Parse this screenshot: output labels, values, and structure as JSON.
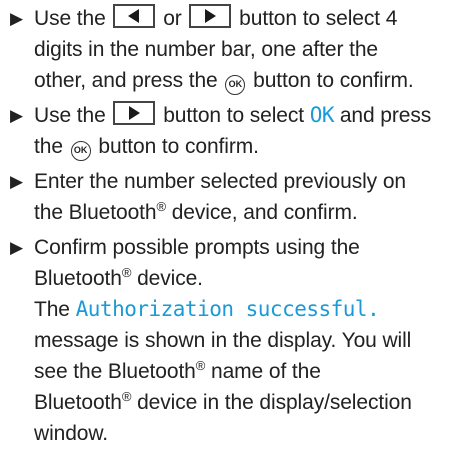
{
  "colors": {
    "text": "#222222",
    "display_text": "#1a9ad6",
    "key_border": "#444444"
  },
  "icons": {
    "bullet": "triangle-right-bullet-icon",
    "left_key": "left-arrow-key-icon",
    "right_key": "right-arrow-key-icon",
    "ok_key": "ok-button-icon"
  },
  "ok_button_label": "OK",
  "reg_mark": "®",
  "step1": {
    "t1": "Use the",
    "t2": "or",
    "t3": "button to select 4",
    "t4": "digits in the number bar, one after the",
    "t5": "other, and press the",
    "t6": "button to confirm."
  },
  "step2": {
    "t1": "Use the",
    "t2": "button to select",
    "display": "OK",
    "t3": "and press",
    "t4": "the",
    "t5": "button to confirm."
  },
  "step3": {
    "t1": "Enter the number selected previously on",
    "t2": "the Bluetooth",
    "t3": "device, and confirm."
  },
  "step4": {
    "t1": "Confirm possible prompts using the",
    "t2": "Bluetooth",
    "t3": "device.",
    "t4": "The",
    "display": "Authorization successful.",
    "t5": "message is shown in the display. You will",
    "t6": "see the Bluetooth",
    "t7": "name of the",
    "t8": "Bluetooth",
    "t9": "device in the display/selection",
    "t10": "window."
  }
}
